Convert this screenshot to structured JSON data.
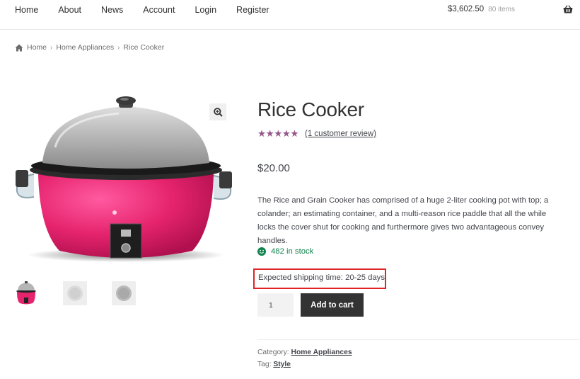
{
  "nav": {
    "items": [
      "Home",
      "About",
      "News",
      "Account",
      "Login",
      "Register"
    ]
  },
  "cart": {
    "amount": "$3,602.50",
    "count": "80 items",
    "icon": "basket-icon"
  },
  "breadcrumb": {
    "icon": "home-icon",
    "items": [
      "Home",
      "Home Appliances",
      "Rice Cooker"
    ],
    "separator": "›"
  },
  "product": {
    "title": "Rice Cooker",
    "stars": "★★★★★",
    "rating_value": 5,
    "rating_max": 5,
    "review_link": "(1 customer review)",
    "price": "$20.00",
    "description": "The Rice and Grain Cooker has comprised of a huge 2-liter cooking pot with top; a colander; an estimating container, and a multi-reason rice paddle that all the while locks the cover shut for cooking and furthermore gives two advantageous convey handles.",
    "stock": "482 in stock",
    "shipping": "Expected shipping time: 20-25 days",
    "quantity": "1",
    "add_to_cart": "Add to cart",
    "category_label": "Category:",
    "category_value": "Home Appliances",
    "tag_label": "Tag:",
    "tag_value": "Style"
  },
  "colors": {
    "star": "#96588a",
    "stock": "#0f834d",
    "button_bg": "#333333",
    "highlight_border": "#e02424",
    "cooker_body": "#e6246e"
  }
}
